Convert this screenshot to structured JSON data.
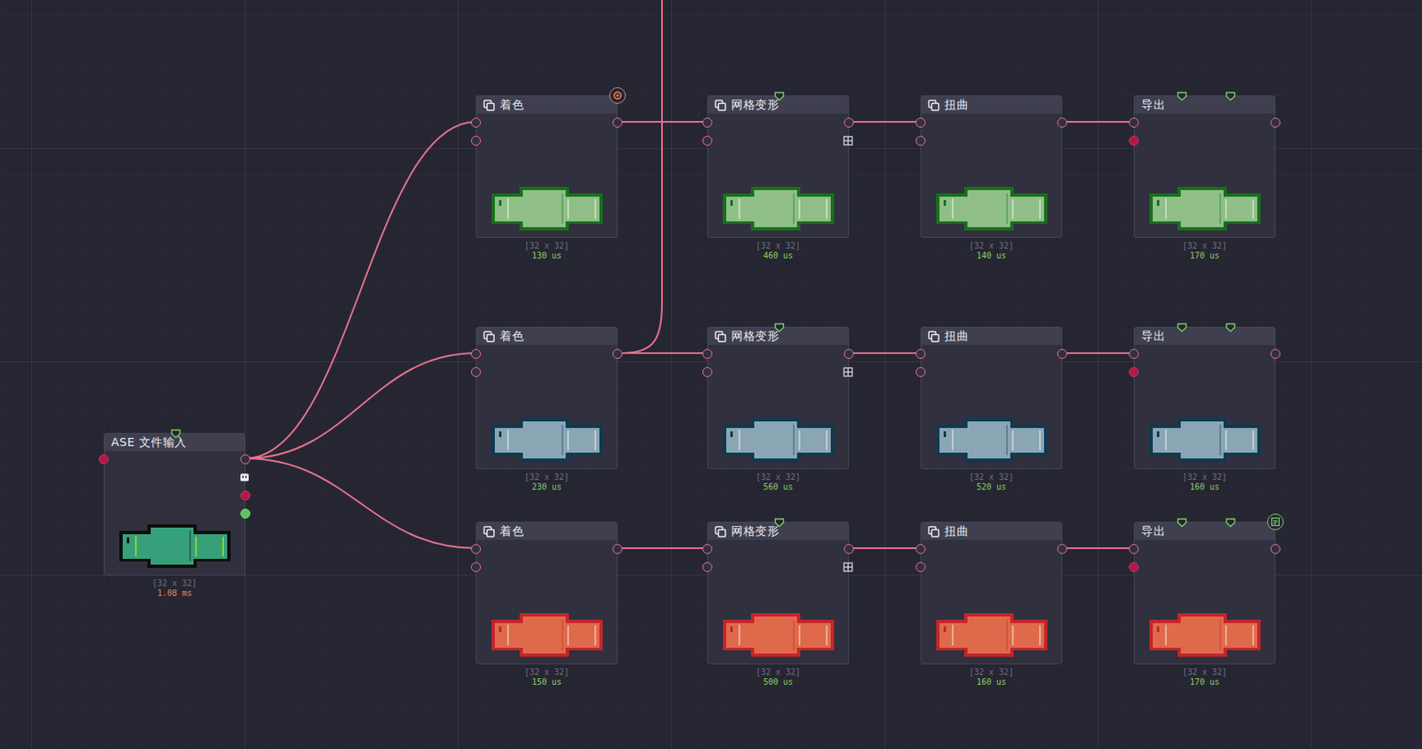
{
  "input": {
    "title": "ASE 文件输入",
    "size": "[32 x 32]",
    "time": "1.08 ms",
    "slow": true,
    "color": "#36a07a",
    "outline": "#0b0f0c"
  },
  "chains": [
    {
      "color": "#8fbf87",
      "outline": "#17701c",
      "linked_up": false,
      "nodes": [
        {
          "kind": "color",
          "title": "着色",
          "size": "[32 x 32]",
          "time": "130 us",
          "previewed": true,
          "output": false
        },
        {
          "kind": "mesh",
          "title": "网格变形",
          "size": "[32 x 32]",
          "time": "460 us",
          "previewed": false,
          "output": false
        },
        {
          "kind": "twist",
          "title": "扭曲",
          "size": "[32 x 32]",
          "time": "140 us",
          "previewed": false,
          "output": false
        },
        {
          "kind": "export",
          "title": "导出",
          "size": "[32 x 32]",
          "time": "170 us",
          "previewed": false,
          "output": false
        }
      ]
    },
    {
      "color": "#8aa6b5",
      "outline": "#0e3a50",
      "linked_up": true,
      "nodes": [
        {
          "kind": "color",
          "title": "着色",
          "size": "[32 x 32]",
          "time": "230 us",
          "previewed": false,
          "output": false
        },
        {
          "kind": "mesh",
          "title": "网格变形",
          "size": "[32 x 32]",
          "time": "560 us",
          "previewed": false,
          "output": false
        },
        {
          "kind": "twist",
          "title": "扭曲",
          "size": "[32 x 32]",
          "time": "520 us",
          "previewed": false,
          "output": false
        },
        {
          "kind": "export",
          "title": "导出",
          "size": "[32 x 32]",
          "time": "160 us",
          "previewed": false,
          "output": false
        }
      ]
    },
    {
      "color": "#df6a4b",
      "outline": "#c4252a",
      "linked_up": false,
      "nodes": [
        {
          "kind": "color",
          "title": "着色",
          "size": "[32 x 32]",
          "time": "150 us",
          "previewed": false,
          "output": false
        },
        {
          "kind": "mesh",
          "title": "网格变形",
          "size": "[32 x 32]",
          "time": "500 us",
          "previewed": false,
          "output": false
        },
        {
          "kind": "twist",
          "title": "扭曲",
          "size": "[32 x 32]",
          "time": "160 us",
          "previewed": false,
          "output": false
        },
        {
          "kind": "export",
          "title": "导出",
          "size": "[32 x 32]",
          "time": "170 us",
          "previewed": false,
          "output": true
        }
      ]
    }
  ]
}
